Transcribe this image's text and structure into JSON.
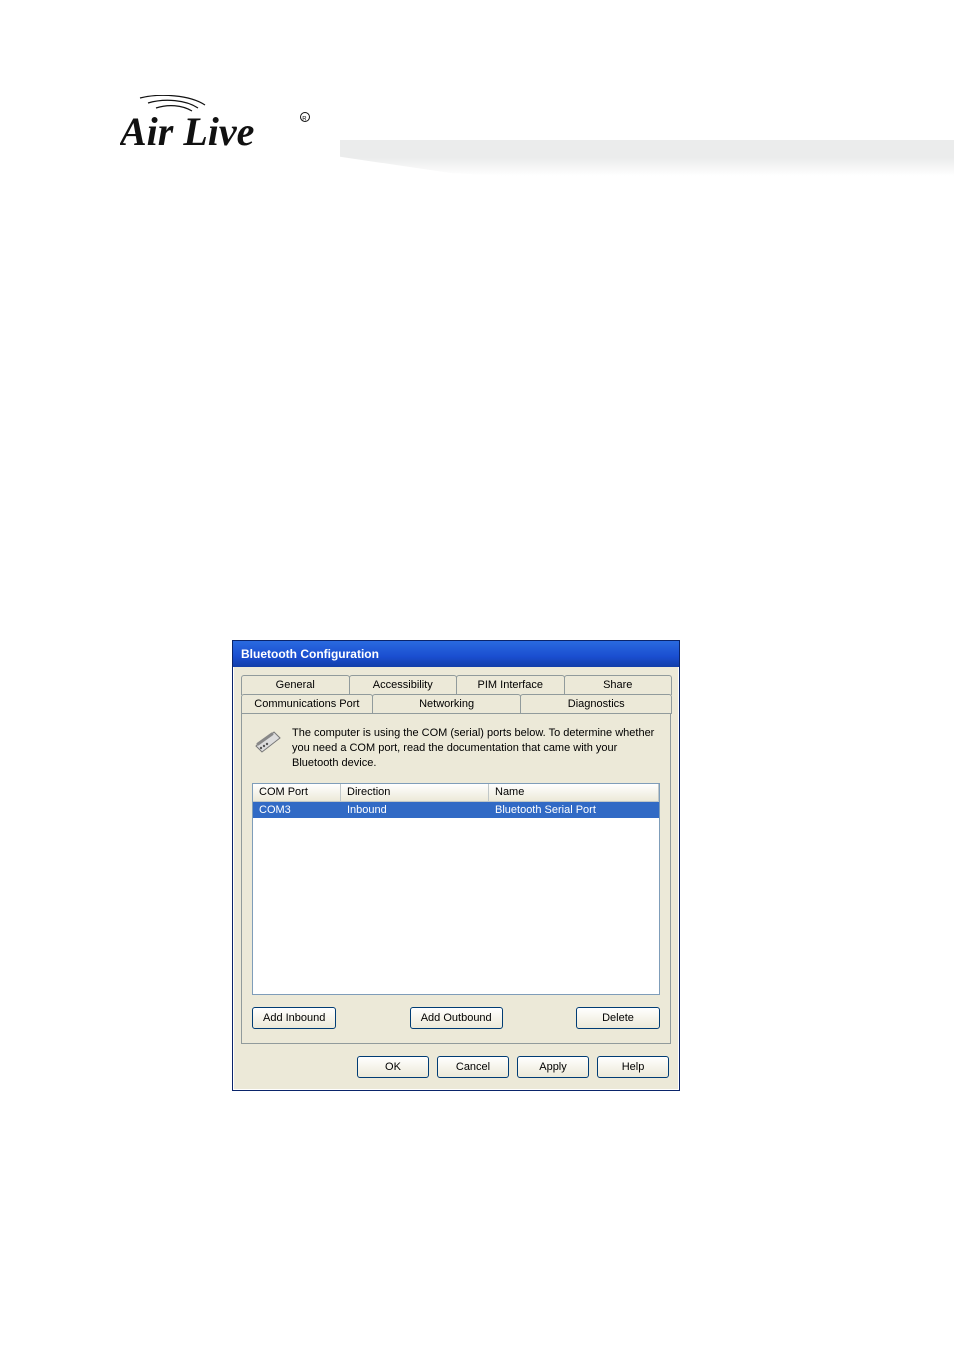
{
  "page": {
    "logo_text": "Air Live"
  },
  "dialog": {
    "title": "Bluetooth Configuration",
    "tab_row_back": [
      {
        "label": "General"
      },
      {
        "label": "Accessibility"
      },
      {
        "label": "PIM Interface"
      },
      {
        "label": "Share"
      }
    ],
    "tab_row_front": [
      {
        "label": "Communications Port",
        "active": true
      },
      {
        "label": "Networking"
      },
      {
        "label": "Diagnostics"
      }
    ],
    "info_text": "The computer is using the COM (serial) ports below.  To determine whether you need a COM port, read the documentation that came with your Bluetooth device.",
    "columns": {
      "c1": "COM Port",
      "c2": "Direction",
      "c3": "Name"
    },
    "rows": [
      {
        "port": "COM3",
        "direction": "Inbound",
        "name": "Bluetooth Serial Port"
      }
    ],
    "panel_buttons": {
      "add_inbound": "Add Inbound",
      "add_outbound": "Add Outbound",
      "delete": "Delete"
    },
    "buttons": {
      "ok": "OK",
      "cancel": "Cancel",
      "apply": "Apply",
      "help": "Help"
    }
  }
}
